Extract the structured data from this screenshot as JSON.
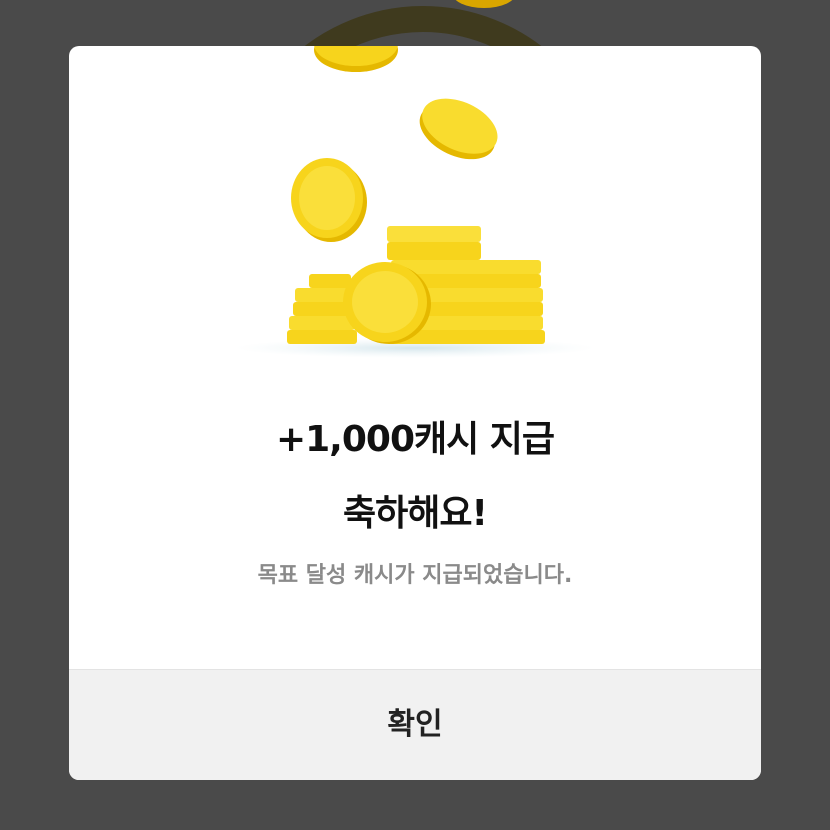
{
  "dialog": {
    "title_line1": "+1,000캐시 지급",
    "title_line2": "축하해요!",
    "message": "목표 달성 캐시가 지급되었습니다.",
    "confirm_label": "확인"
  },
  "illustration": {
    "icon": "coins-icon"
  },
  "colors": {
    "backdrop": "#4a4a4a",
    "modal": "#ffffff",
    "footer": "#f1f1f1",
    "coin": "#f7d41c",
    "coin_shadow": "#e5b800",
    "message": "#8a8a8a"
  }
}
